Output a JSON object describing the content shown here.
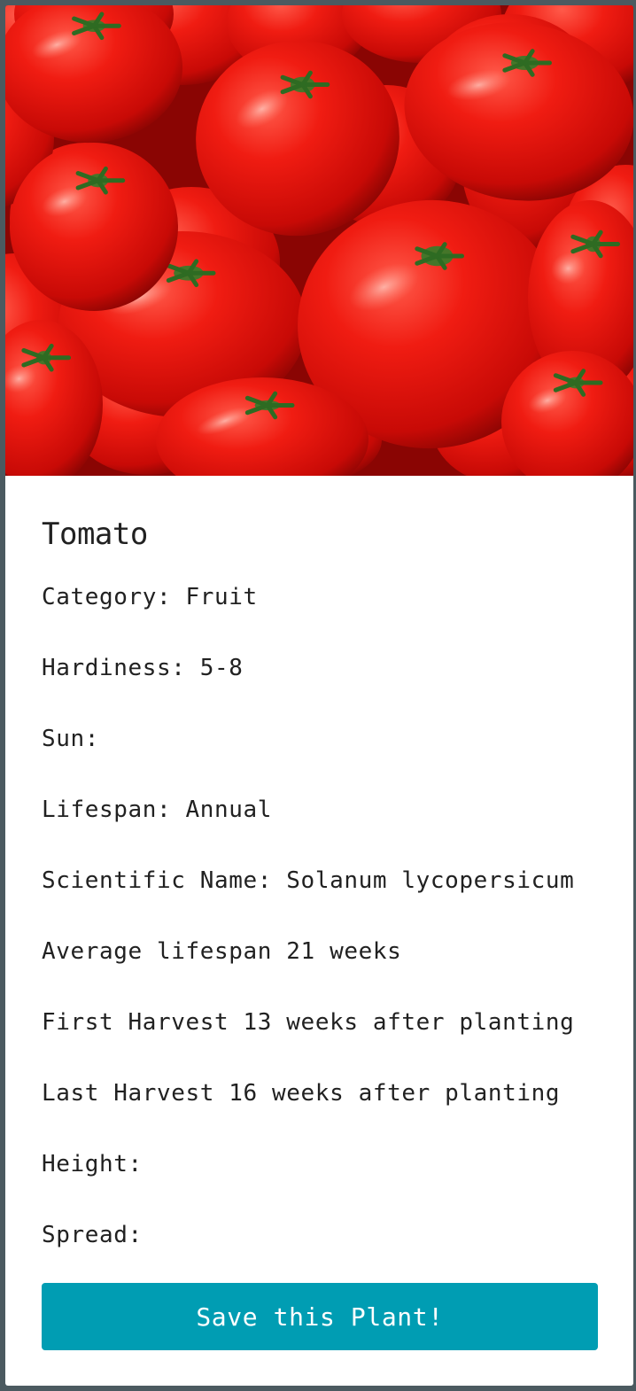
{
  "plant": {
    "image_subject": "tomatoes",
    "name": "Tomato",
    "fields": {
      "category": "Category: Fruit",
      "hardiness": "Hardiness: 5-8",
      "sun": "Sun:",
      "lifespan": "Lifespan: Annual",
      "scientific_name": "Scientific Name: Solanum lycopersicum",
      "average_lifespan": "Average lifespan 21 weeks",
      "first_harvest": "First Harvest 13 weeks after planting",
      "last_harvest": "Last Harvest 16 weeks after planting",
      "height": "Height:",
      "spread": "Spread:"
    }
  },
  "actions": {
    "save_label": "Save this Plant!"
  },
  "colors": {
    "page_background": "#4b5a60",
    "card_background": "#ffffff",
    "button_background": "#009db3",
    "button_text": "#ffffff",
    "text": "#212121"
  }
}
